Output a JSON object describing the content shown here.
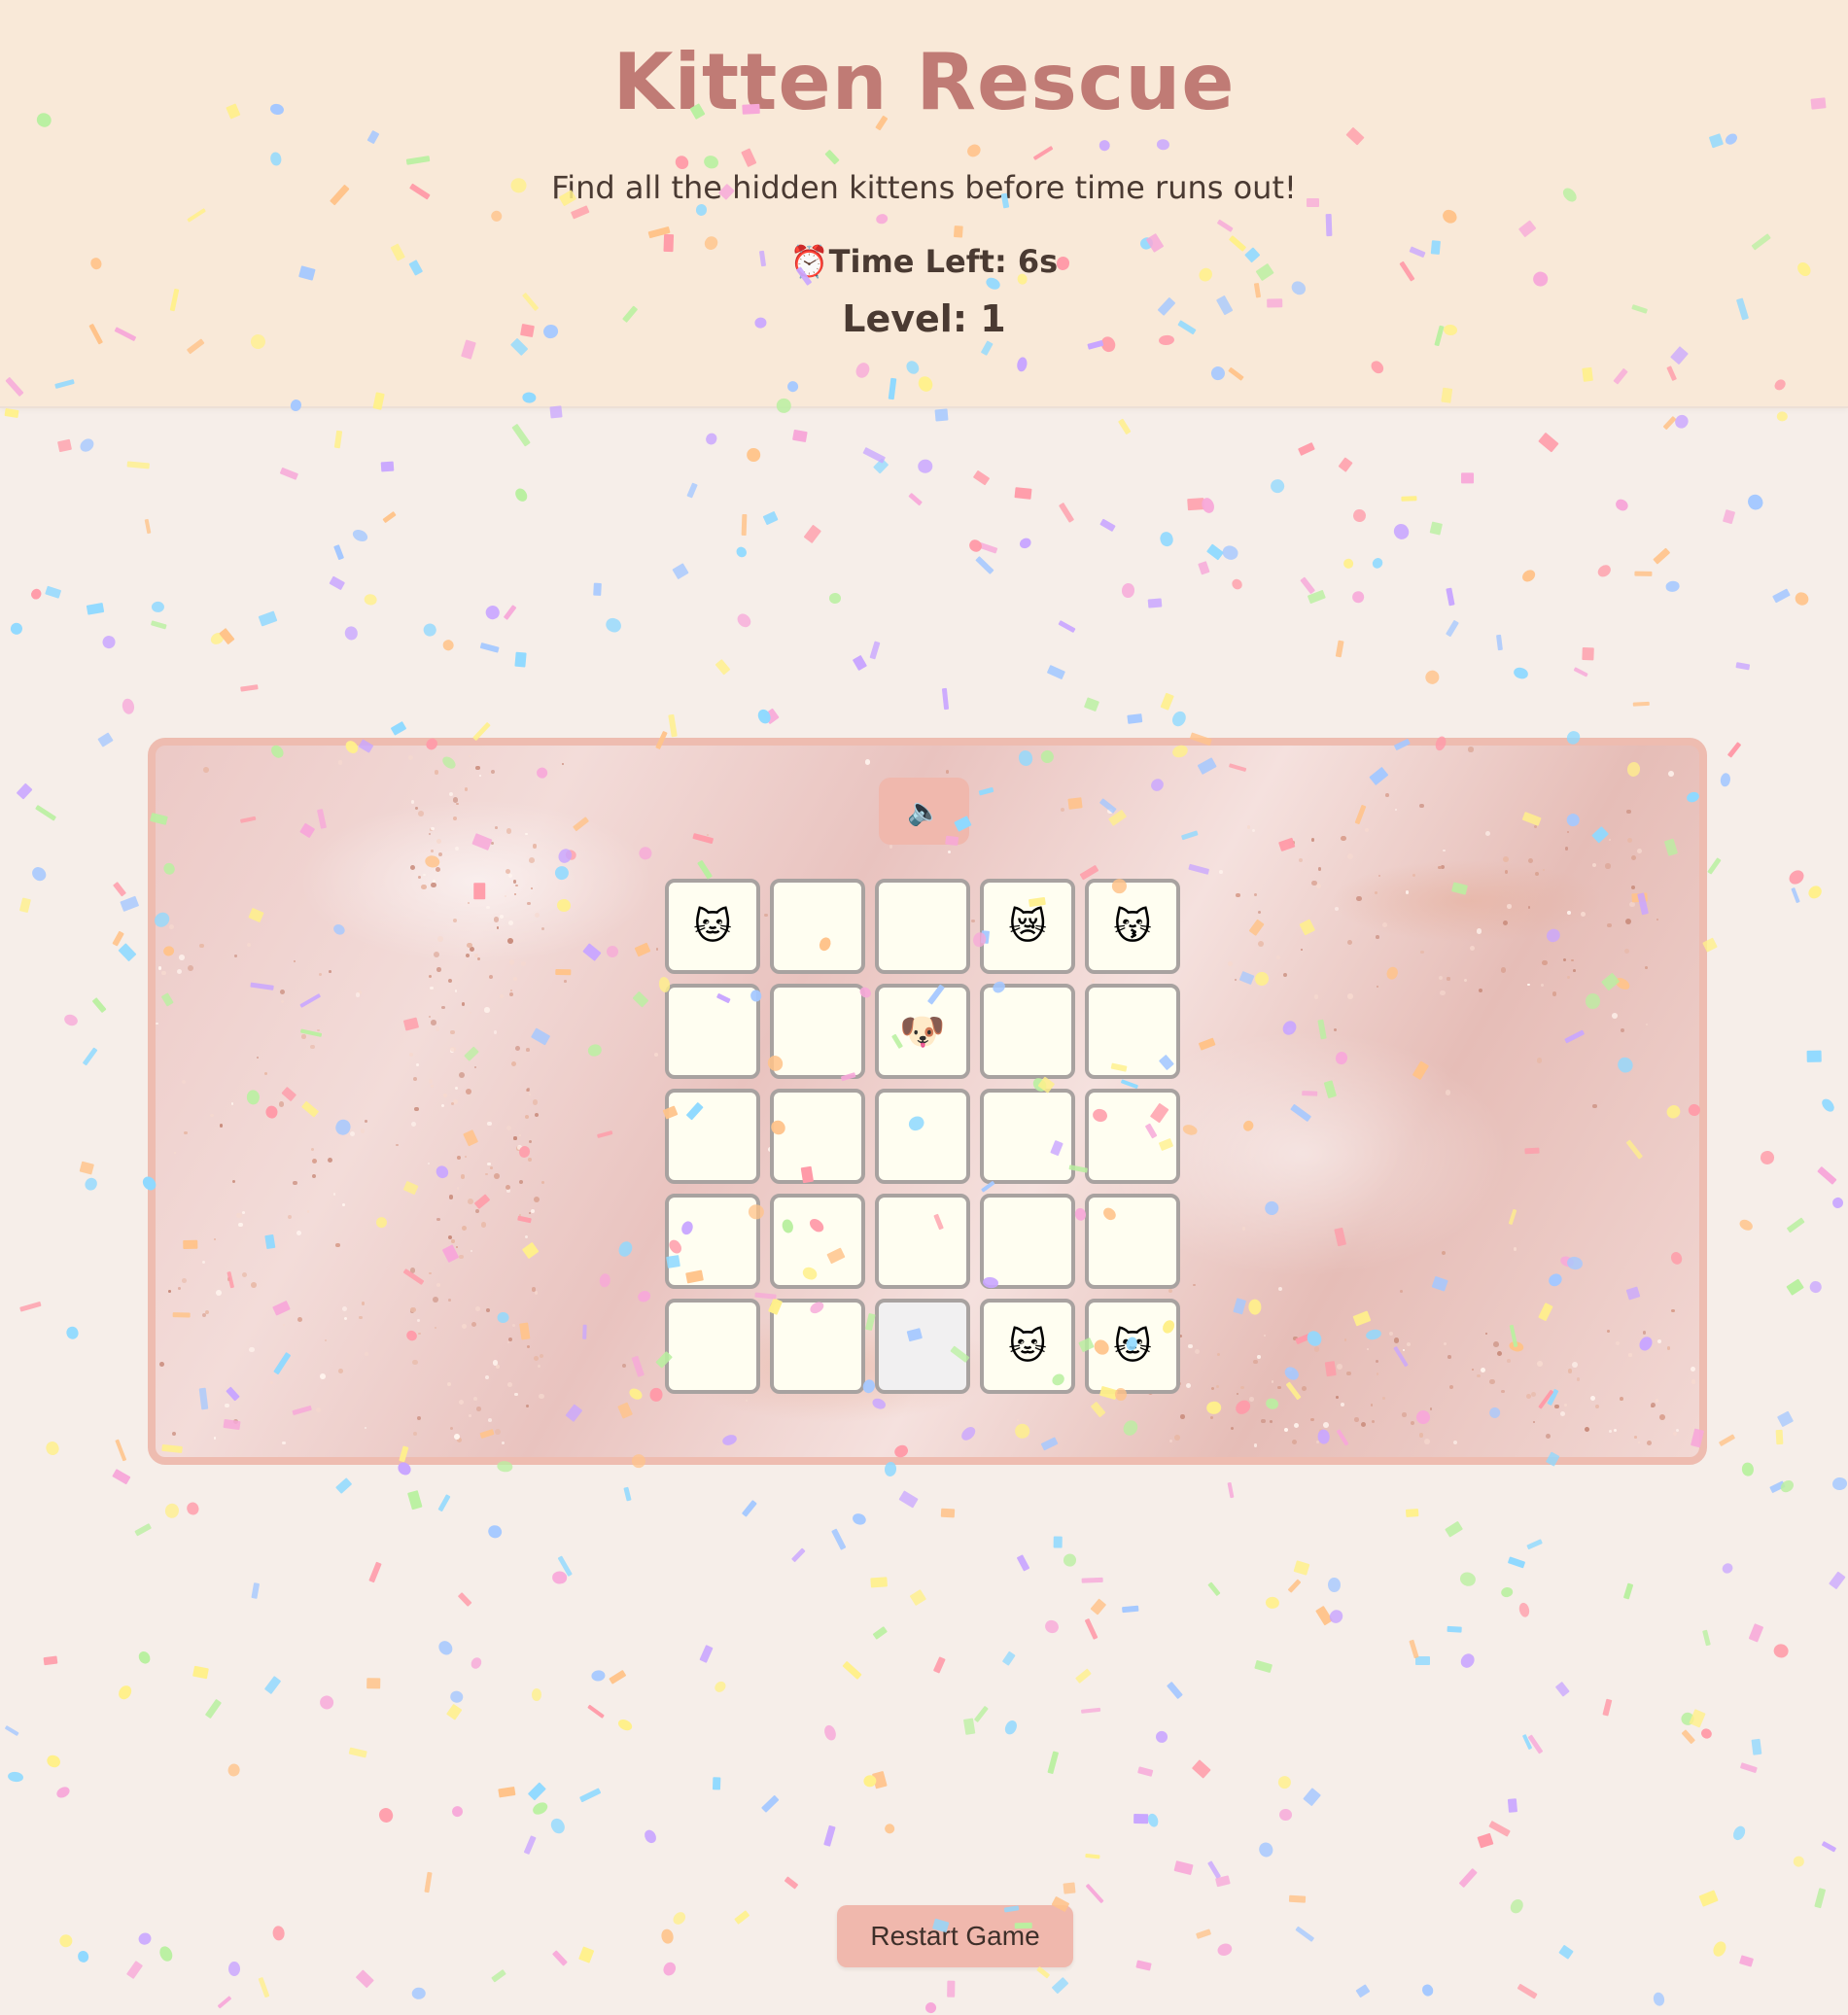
{
  "header": {
    "title": "Kitten Rescue",
    "subtitle": "Find all the hidden kittens before time runs out!",
    "timer_icon": "⏰",
    "timer_text": "Time Left: 6s",
    "level_text": "Level: 1"
  },
  "mute_button": {
    "icon": "🔈",
    "icon_name": "muted-speaker-icon"
  },
  "grid": {
    "rows": 5,
    "cols": 5,
    "cells": [
      "🐱",
      "",
      "",
      "😿",
      "😽",
      "",
      "",
      "🐶",
      "",
      "",
      "",
      "",
      "",
      "",
      "",
      "",
      "",
      "",
      "",
      "",
      "",
      "",
      "",
      "🐱",
      "🐱"
    ],
    "gray_cell_index": 22
  },
  "restart_label": "Restart Game",
  "colors": {
    "header_bg": "#f9e9d8",
    "page_bg": "#f6eee9",
    "title": "#c07b75",
    "button": "#f0b8ad",
    "board_border": "#eebcb0",
    "cell_bg": "#fffef1"
  },
  "confetti_colors": [
    "#f7a8d9",
    "#a5c8ff",
    "#b9f0a0",
    "#fff08a",
    "#ffc38a",
    "#c9a6ff",
    "#ff9aa8",
    "#8fd9ff"
  ]
}
